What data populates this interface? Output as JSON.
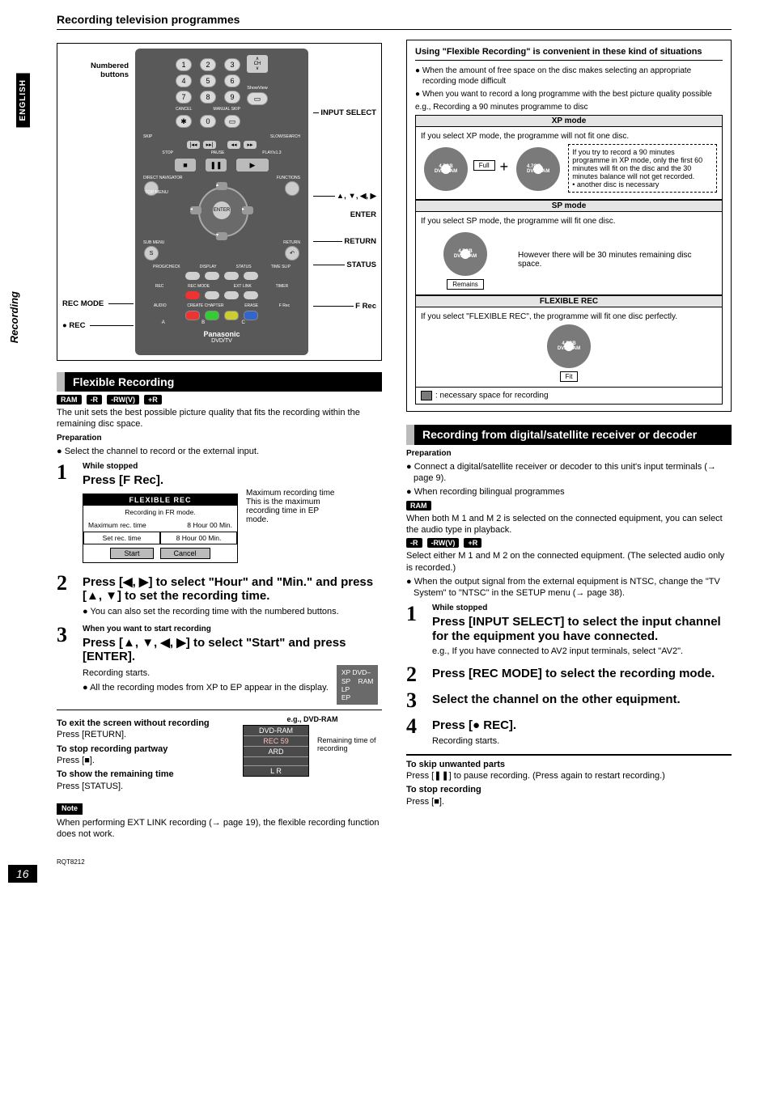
{
  "header": {
    "title": "Recording television programmes"
  },
  "side": {
    "eng": "ENGLISH",
    "section": "Recording"
  },
  "remote": {
    "left_labels": {
      "numbered": "Numbered buttons",
      "rec_mode": "REC MODE",
      "rec": "● REC"
    },
    "right_labels": {
      "input_select": "INPUT SELECT",
      "arrows": "▲, ▼, ◀, ▶",
      "enter": "ENTER",
      "return": "RETURN",
      "status": "STATUS",
      "frec": "F Rec"
    },
    "body": {
      "numpad": [
        "1",
        "2",
        "3",
        "4",
        "5",
        "6",
        "7",
        "8",
        "9",
        "✱",
        "0"
      ],
      "ch": "CH",
      "showview": "ShowView",
      "cancel": "CANCEL",
      "manual_skip": "MANUAL SKIP",
      "skip": "SKIP",
      "slow": "SLOW/SEARCH",
      "stop": "STOP",
      "pause": "PAUSE",
      "play": "PLAY/x1.3",
      "direct_nav": "DIRECT NAVIGATOR",
      "functions": "FUNCTIONS",
      "top_menu": "TOP MENU",
      "enter": "ENTER",
      "sub_menu": "SUB MENU",
      "return": "RETURN",
      "progcheck": "PROG/CHECK",
      "display": "DISPLAY",
      "status": "STATUS",
      "time_slip": "TIME SLIP",
      "s": "S",
      "rec": "REC",
      "recmode": "REC MODE",
      "extlink": "EXT LINK",
      "timer": "TIMER",
      "audio": "AUDIO",
      "create_chapter": "CREATE CHAPTER",
      "erase": "ERASE",
      "frec": "F Rec",
      "a": "A",
      "b": "B",
      "c": "C",
      "brand": "Panasonic",
      "dvdtv": "DVD/TV"
    }
  },
  "flex_rec": {
    "title": "Flexible Recording",
    "chips": [
      "RAM",
      "-R",
      "-RW(V)",
      "+R"
    ],
    "intro": "The unit sets the best possible picture quality that fits the recording within the remaining disc space.",
    "prep_h": "Preparation",
    "prep_b": "Select the channel to record or the external input.",
    "step1": {
      "sub": "While stopped",
      "instr": "Press [F Rec].",
      "osd": {
        "title": "FLEXIBLE REC",
        "line1": "Recording in FR mode.",
        "max_label": "Maximum rec. time",
        "max_val": "8 Hour 00 Min.",
        "set_label": "Set rec. time",
        "set_val": "8 Hour 00 Min.",
        "start": "Start",
        "cancel": "Cancel"
      },
      "side_h": "Maximum recording time",
      "side_b": "This is the maximum recording time in EP mode."
    },
    "step2": {
      "instr": "Press [◀, ▶] to select \"Hour\" and \"Min.\" and press [▲, ▼] to set the recording time.",
      "note": "You can also set the recording time with the numbered buttons."
    },
    "step3": {
      "sub": "When you want to start recording",
      "instr": "Press [▲, ▼, ◀, ▶] to select \"Start\" and press [ENTER].",
      "line1": "Recording starts.",
      "line2": "All the recording modes from XP to EP appear in the display.",
      "badge": "XP DVD–\nSP    RAM\nLP\nEP"
    },
    "exit_h": "To exit the screen without recording",
    "exit_b": "Press [RETURN].",
    "stop_h": "To stop recording partway",
    "stop_b": "Press [■].",
    "show_h": "To show the remaining time",
    "show_b": "Press [STATUS].",
    "disp_eg": "e.g., DVD-RAM",
    "disp": {
      "r1": "DVD-RAM",
      "r2": "REC 59",
      "r3": "ARD",
      "r4": "",
      "r5": "L R"
    },
    "rem_label": "Remaining time of recording",
    "note_h": "Note",
    "note_b": "When performing EXT LINK recording (→ page 19), the flexible recording function does not work."
  },
  "situations": {
    "head": "Using \"Flexible Recording\" is convenient in these kind of situations",
    "b1": "When the amount of free space on the disc makes selecting an appropriate recording mode difficult",
    "b2": "When you want to record a long programme with the best picture quality possible",
    "eg": "e.g., Recording a 90 minutes programme to disc",
    "xp_h": "XP mode",
    "xp_t": "If you select XP mode, the programme will not fit one disc.",
    "xp_box": "If you try to record a 90 minutes programme in XP mode, only the first 60 minutes will fit on the disc and the 30 minutes balance will not get recorded.\n• another disc is necessary",
    "disc_label": "4.7GB\nDVD-RAM",
    "full": "Full",
    "sp_h": "SP mode",
    "sp_t": "If you select SP mode, the programme will fit one disc.",
    "sp_side": "However there will be 30 minutes remaining disc space.",
    "remains": "Remains",
    "fr_h": "FLEXIBLE REC",
    "fr_t": "If you select \"FLEXIBLE REC\", the programme will fit one disc perfectly.",
    "fit": "Fit",
    "legend": ": necessary space for recording"
  },
  "digital": {
    "title": "Recording from digital/satellite receiver or decoder",
    "prep_h": "Preparation",
    "b1": "Connect a digital/satellite receiver or decoder to this unit's input terminals (→ page 9).",
    "b2": "When recording bilingual programmes",
    "ram_chip": "RAM",
    "ram_text": "When both M 1 and M 2 is selected on the connected equipment, you can select the audio type in playback.",
    "chips2": [
      "-R",
      "-RW(V)",
      "+R"
    ],
    "sel_text": "Select either M 1 and M 2 on the connected equipment. (The selected audio only is recorded.)",
    "b3": "When the output signal from the external equipment is NTSC, change the \"TV System\" to \"NTSC\" in the SETUP menu (→ page 38).",
    "step1_sub": "While stopped",
    "step1": "Press [INPUT SELECT] to select the input channel for the equipment you have connected.",
    "step1_eg": "e.g., If you have connected to AV2 input terminals, select \"AV2\".",
    "step2": "Press [REC MODE] to select the recording mode.",
    "step3": "Select the channel on the other equipment.",
    "step4": "Press [● REC].",
    "step4_b": "Recording starts.",
    "skip_h": "To skip unwanted parts",
    "skip_b": "Press [❚❚] to pause recording. (Press again to restart recording.)",
    "stop_h": "To stop recording",
    "stop_b": "Press [■]."
  },
  "footer": {
    "rqt": "RQT8212",
    "page": "16"
  }
}
